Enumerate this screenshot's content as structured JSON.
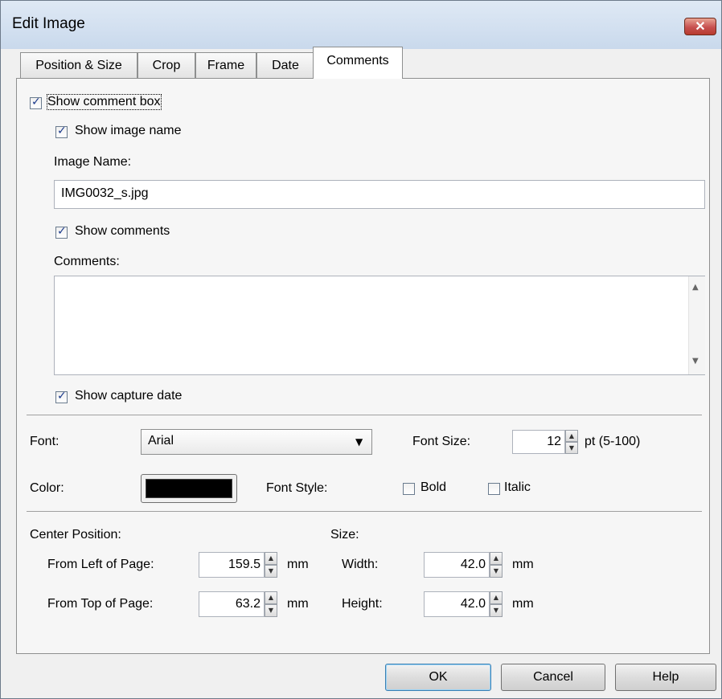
{
  "window": {
    "title": "Edit Image",
    "close_glyph": "✕"
  },
  "tabs": [
    {
      "label": "Position & Size"
    },
    {
      "label": "Crop"
    },
    {
      "label": "Frame"
    },
    {
      "label": "Date"
    },
    {
      "label": "Comments"
    }
  ],
  "comments": {
    "show_comment_box": {
      "label": "Show comment box",
      "checked": true
    },
    "show_image_name": {
      "label": "Show image name",
      "checked": true
    },
    "image_name_label": "Image Name:",
    "image_name_value": "IMG0032_s.jpg",
    "show_comments": {
      "label": "Show comments",
      "checked": true
    },
    "comments_label": "Comments:",
    "comments_value": "",
    "show_capture_date": {
      "label": "Show capture date",
      "checked": true
    }
  },
  "font": {
    "font_label": "Font:",
    "font_value": "Arial",
    "font_size_label": "Font Size:",
    "font_size_value": "12",
    "font_size_unit": "pt (5-100)",
    "color_label": "Color:",
    "color_value": "#000000",
    "font_style_label": "Font Style:",
    "bold_label": "Bold",
    "bold_checked": false,
    "italic_label": "Italic",
    "italic_checked": false
  },
  "position": {
    "center_label": "Center Position:",
    "left_label": "From Left of Page:",
    "left_value": "159.5",
    "top_label": "From Top of Page:",
    "top_value": "63.2",
    "unit": "mm"
  },
  "size": {
    "size_label": "Size:",
    "width_label": "Width:",
    "width_value": "42.0",
    "height_label": "Height:",
    "height_value": "42.0",
    "unit": "mm"
  },
  "buttons": {
    "ok": "OK",
    "cancel": "Cancel",
    "help": "Help"
  },
  "icons": {
    "dropdown": "▼",
    "scroll_up": "▲",
    "scroll_down": "▼",
    "spin_up": "▲",
    "spin_down": "▼"
  }
}
